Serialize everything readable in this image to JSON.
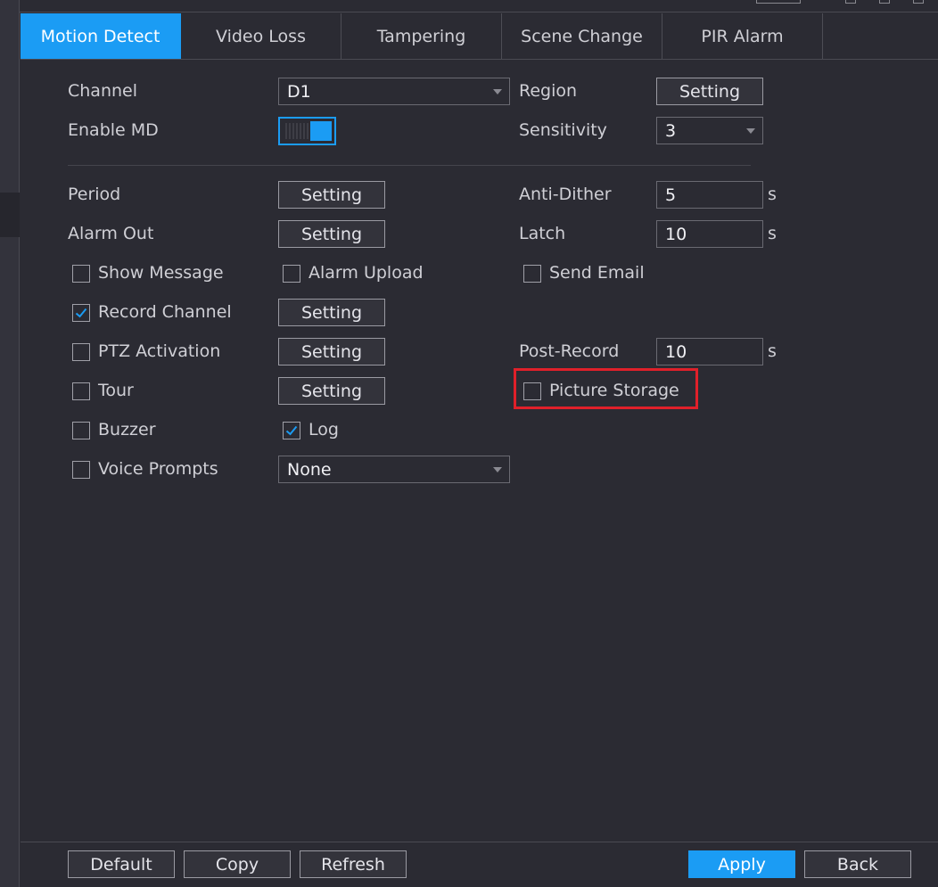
{
  "tabs": [
    {
      "label": "Motion Detect",
      "active": true
    },
    {
      "label": "Video Loss",
      "active": false
    },
    {
      "label": "Tampering",
      "active": false
    },
    {
      "label": "Scene Change",
      "active": false
    },
    {
      "label": "PIR Alarm",
      "active": false
    }
  ],
  "form": {
    "channel_label": "Channel",
    "channel_value": "D1",
    "region_label": "Region",
    "region_button": "Setting",
    "enable_md_label": "Enable MD",
    "enable_md_on": true,
    "sensitivity_label": "Sensitivity",
    "sensitivity_value": "3",
    "period_label": "Period",
    "period_button": "Setting",
    "anti_dither_label": "Anti-Dither",
    "anti_dither_value": "5",
    "anti_dither_unit": "s",
    "alarm_out_label": "Alarm Out",
    "alarm_out_button": "Setting",
    "latch_label": "Latch",
    "latch_value": "10",
    "latch_unit": "s",
    "show_message_label": "Show Message",
    "show_message_checked": false,
    "alarm_upload_label": "Alarm Upload",
    "alarm_upload_checked": false,
    "send_email_label": "Send Email",
    "send_email_checked": false,
    "record_channel_label": "Record Channel",
    "record_channel_checked": true,
    "record_channel_button": "Setting",
    "ptz_label": "PTZ Activation",
    "ptz_checked": false,
    "ptz_button": "Setting",
    "post_record_label": "Post-Record",
    "post_record_value": "10",
    "post_record_unit": "s",
    "tour_label": "Tour",
    "tour_checked": false,
    "tour_button": "Setting",
    "picture_storage_label": "Picture Storage",
    "picture_storage_checked": false,
    "buzzer_label": "Buzzer",
    "buzzer_checked": false,
    "log_label": "Log",
    "log_checked": true,
    "voice_prompts_label": "Voice Prompts",
    "voice_prompts_checked": false,
    "voice_prompts_value": "None"
  },
  "footer": {
    "default_label": "Default",
    "copy_label": "Copy",
    "refresh_label": "Refresh",
    "apply_label": "Apply",
    "back_label": "Back"
  },
  "colors": {
    "accent": "#1b9cf4",
    "background": "#2b2b33",
    "highlight": "#e0202a"
  }
}
